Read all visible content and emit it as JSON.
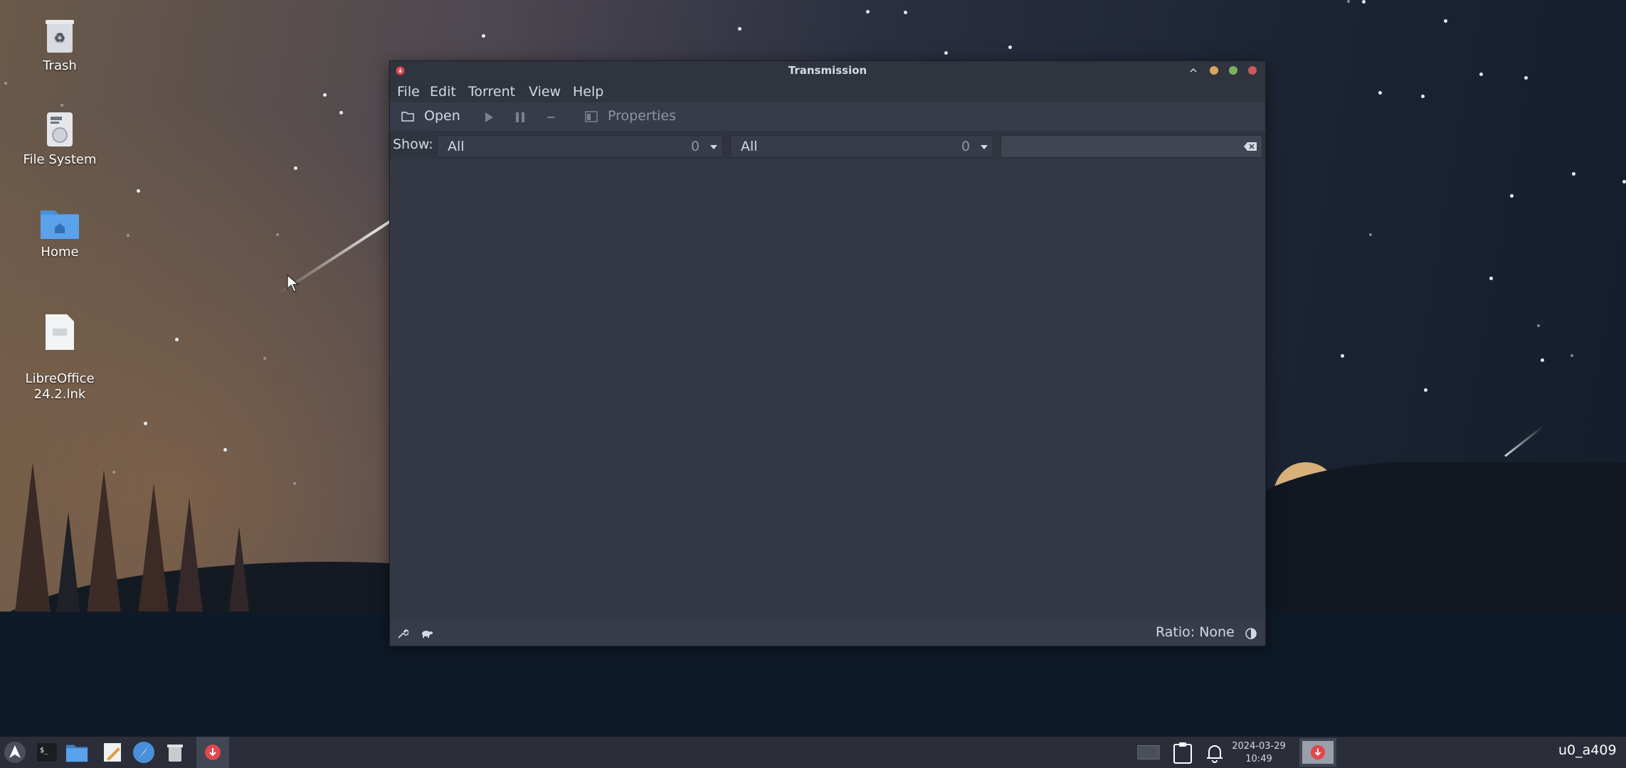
{
  "desktop": {
    "icons": [
      {
        "label": "Trash",
        "icon": "trash-icon"
      },
      {
        "label": "File System",
        "icon": "drive-icon"
      },
      {
        "label": "Home",
        "icon": "home-folder-icon"
      },
      {
        "label": "LibreOffice\n24.2.lnk",
        "icon": "document-icon"
      }
    ]
  },
  "window": {
    "title": "Transmission",
    "menu": [
      "File",
      "Edit",
      "Torrent",
      "View",
      "Help"
    ],
    "toolbar": {
      "open_label": "Open",
      "properties_label": "Properties"
    },
    "filter": {
      "show_label": "Show:",
      "activity": {
        "selected": "All",
        "count": "0"
      },
      "tracker": {
        "selected": "All",
        "count": "0"
      },
      "search_value": ""
    },
    "statusbar": {
      "ratio_label": "Ratio: None"
    }
  },
  "taskbar": {
    "date": "2024-03-29",
    "time": "10:49",
    "user": "u0_a409"
  },
  "colors": {
    "window_bg": "#2f343f",
    "toolbar_bg": "#383c4a",
    "close_button": "#cc575d",
    "maximize_button": "#7bb35c",
    "minimize_button": "#d7a65d",
    "transmission_red": "#e0474c"
  }
}
